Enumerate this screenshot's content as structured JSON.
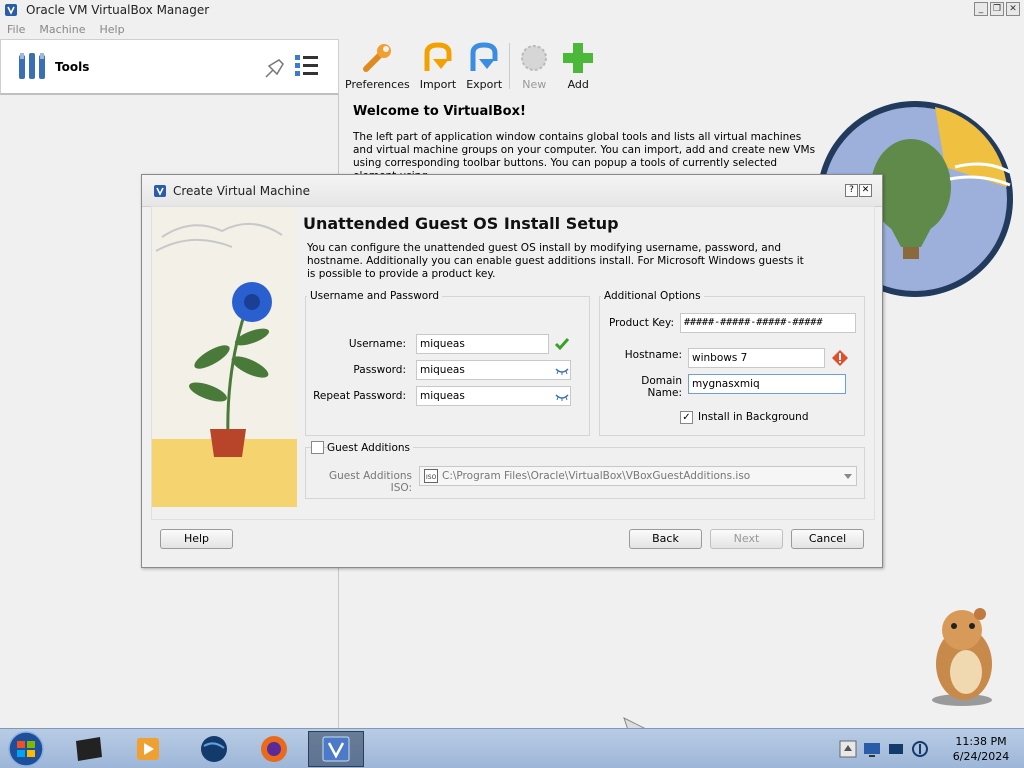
{
  "window": {
    "title": "Oracle VM VirtualBox Manager",
    "controls": [
      "_",
      "❐",
      "✕"
    ]
  },
  "menu": [
    "File",
    "Machine",
    "Help"
  ],
  "tools": {
    "label": "Tools"
  },
  "toolbar": [
    {
      "label": "Preferences",
      "icon": "preferences-icon",
      "enabled": true
    },
    {
      "label": "Import",
      "icon": "import-icon",
      "enabled": true
    },
    {
      "label": "Export",
      "icon": "export-icon",
      "enabled": true
    },
    {
      "label": "New",
      "icon": "new-icon",
      "enabled": false
    },
    {
      "label": "Add",
      "icon": "add-icon",
      "enabled": true
    }
  ],
  "welcome": {
    "title": "Welcome to VirtualBox!",
    "text": "The left part of application window contains global tools and lists all virtual machines and virtual machine groups on your computer. You can import, add and create new VMs using corresponding toolbar buttons. You can popup a tools of currently selected element using"
  },
  "dialog": {
    "title": "Create Virtual Machine",
    "title_buttons": [
      "?",
      "✕"
    ],
    "page_title": "Unattended Guest OS Install Setup",
    "description": "You can configure the unattended guest OS install by modifying username, password, and hostname. Additionally you can enable guest additions install. For Microsoft Windows guests it is possible to provide a product key.",
    "user_group": {
      "title": "Username and Password",
      "username_label": "Username:",
      "username": "miqueas",
      "password_label": "Password:",
      "password": "miqueas",
      "repeat_label": "Repeat Password:",
      "repeat": "miqueas"
    },
    "options_group": {
      "title": "Additional Options",
      "product_key_label": "Product Key:",
      "product_key": "#####-#####-#####-#####",
      "hostname_label": "Hostname:",
      "hostname": "winbows 7",
      "domain_label": "Domain Name:",
      "domain": "mygnasxmiq",
      "install_bg_label": "Install in Background",
      "install_bg_checked": true
    },
    "guest_additions": {
      "label": "Guest Additions",
      "checked": false,
      "iso_label": "Guest Additions ISO:",
      "iso_path": "C:\\Program Files\\Oracle\\VirtualBox\\VBoxGuestAdditions.iso"
    },
    "buttons": {
      "help": "Help",
      "back": "Back",
      "next": "Next",
      "cancel": "Cancel"
    }
  },
  "taskbar": {
    "time": "11:38 PM",
    "date": "6/24/2024"
  }
}
